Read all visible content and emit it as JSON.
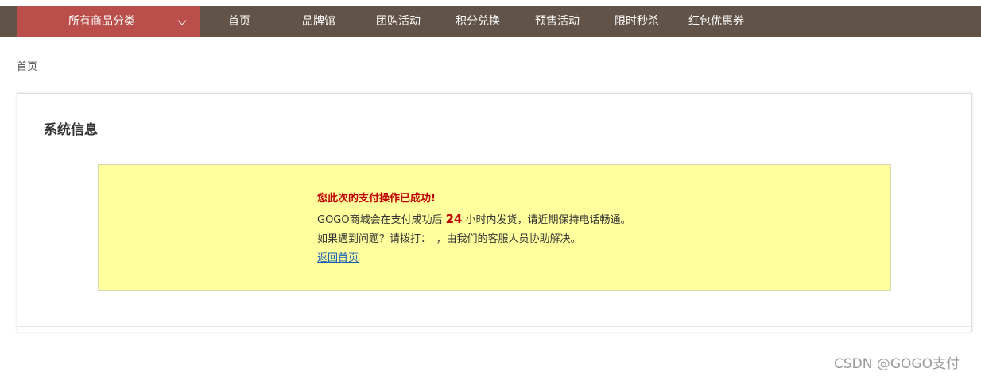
{
  "topbar": {
    "all_categories_label": "所有商品分类",
    "nav_items": [
      "首页",
      "品牌馆",
      "团购活动",
      "积分兑换",
      "预售活动",
      "限时秒杀",
      "红包优惠券"
    ]
  },
  "breadcrumb": {
    "home": "首页"
  },
  "panel": {
    "title": "系统信息",
    "notice": {
      "success": "您此次的支付操作已成功!",
      "line1_prefix": "GOGO商城会在支付成功后",
      "line1_hours": "24",
      "line1_suffix": "小时内发货，请近期保持电话畅通。",
      "line2": "如果遇到问题？请拨打：　，由我们的客服人员协助解决。",
      "back_link": "返回首页"
    }
  },
  "watermark": "CSDN @GOGO支付",
  "colors": {
    "topbar_bg": "#625348",
    "categories_bg": "#b94e4a",
    "notice_bg": "#ffff9d",
    "success_text": "#c00000",
    "link": "#1a5fb4"
  }
}
